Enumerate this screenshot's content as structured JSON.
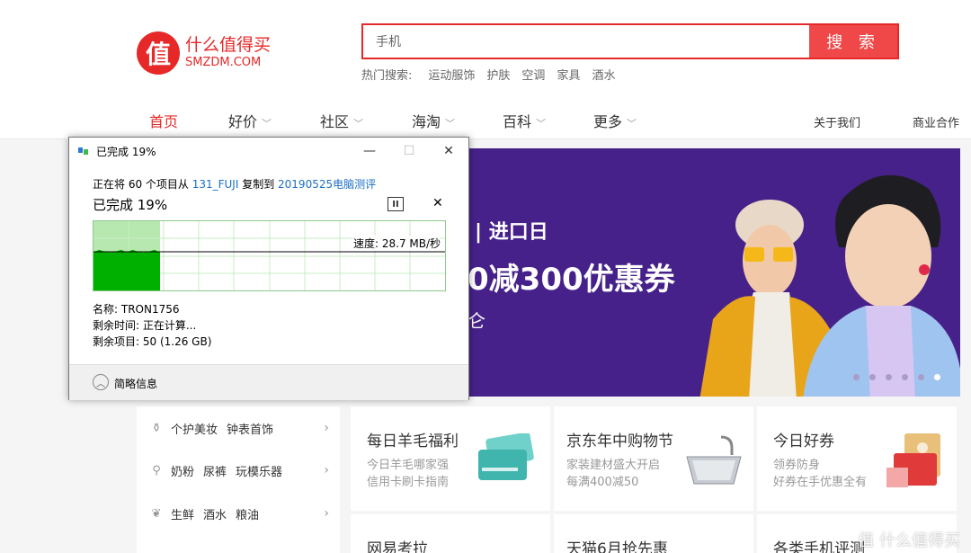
{
  "header": {
    "logo_mark": "值",
    "logo_cn": "什么值得买",
    "logo_en": "SMZDM.COM",
    "search_value": "手机",
    "search_button": "搜 索",
    "hot_label": "热门搜索:",
    "hot_terms": [
      "运动服饰",
      "护肤",
      "空调",
      "家具",
      "酒水"
    ]
  },
  "nav": {
    "items": [
      {
        "label": "首页"
      },
      {
        "label": "好价"
      },
      {
        "label": "社区"
      },
      {
        "label": "海淘"
      },
      {
        "label": "百科"
      },
      {
        "label": "更多"
      }
    ],
    "right": [
      "关于我们",
      "商业合作"
    ]
  },
  "banner": {
    "text1": "| 进口日",
    "text2": "0减300优惠券",
    "text3": "仑",
    "slides": 6,
    "active_slide": 6
  },
  "left_menu": [
    {
      "icon": "bottle-icon",
      "items": [
        "个护美妆",
        "钟表首饰"
      ]
    },
    {
      "icon": "bottle-feed-icon",
      "items": [
        "奶粉",
        "尿裤",
        "玩模乐器"
      ]
    },
    {
      "icon": "leaf-icon",
      "items": [
        "生鲜",
        "酒水",
        "粮油"
      ]
    }
  ],
  "cards": [
    {
      "title": "每日羊毛福利",
      "sub1": "今日羊毛哪家强",
      "sub2": "信用卡刷卡指南"
    },
    {
      "title": "京东年中购物节",
      "sub1": "家装建材盛大开启",
      "sub2": "每满400减50"
    },
    {
      "title": "今日好券",
      "sub1": "领券防身",
      "sub2": "好券在手优惠全有"
    }
  ],
  "cards_row2": [
    "网易考拉",
    "天猫6月抢先惠",
    "各类手机评测"
  ],
  "watermark": "值 什么值得买",
  "dialog": {
    "title": "已完成 19%",
    "line_prefix": "正在将 60 个项目从 ",
    "source": "131_FUJI",
    "line_mid": " 复制到 ",
    "dest": "20190525电脑测评",
    "percent_text": "已完成 19%",
    "progress": 0.19,
    "speed": "速度: 28.7 MB/秒",
    "name": "名称: TRON1756",
    "time_left": "剩余时间: 正在计算...",
    "items_left": "剩余项目: 50 (1.26 GB)",
    "less_details": "简略信息",
    "minimize": "—",
    "maximize": "☐",
    "close": "✕",
    "pause": "II",
    "cancel": "✕"
  },
  "colors": {
    "brand": "#e62828",
    "banner_bg": "#46218a",
    "graph_fill": "#00b000",
    "link": "#1a6fc4"
  }
}
